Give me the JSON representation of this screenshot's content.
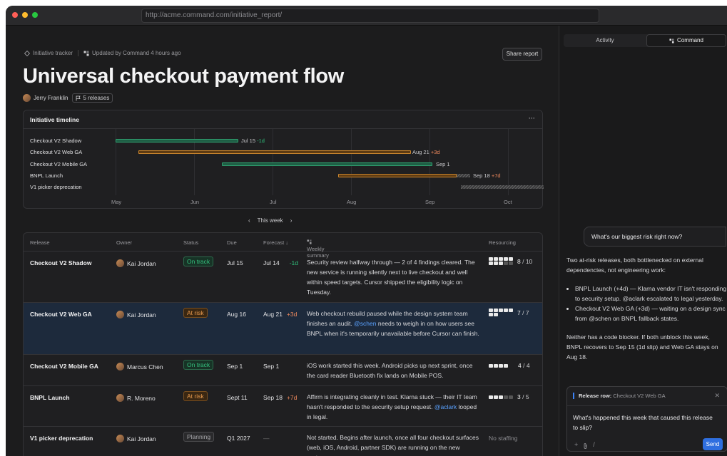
{
  "browser": {
    "url": "http://acme.command.com/initiative_report/"
  },
  "breadcrumbs": {
    "tracker": "Initiative tracker",
    "updated": "Updated by Command 4 hours ago"
  },
  "header": {
    "share_label": "Share report",
    "title": "Universal checkout payment flow",
    "owner": "Jerry Franklin",
    "releases_pill": "5 releases"
  },
  "timeline": {
    "title": "Initiative timeline",
    "more": "···",
    "months": [
      "May",
      "Jun",
      "Jul",
      "Aug",
      "Sep",
      "Oct"
    ],
    "rows": [
      {
        "label": "Checkout V2 Shadow",
        "note": "Jul 15",
        "delta": "-1d",
        "tone": "green"
      },
      {
        "label": "Checkout V2 Web GA",
        "note": "Aug 21",
        "delta": "+3d",
        "tone": "orange"
      },
      {
        "label": "Checkout V2 Mobile GA",
        "note": "Sep 1",
        "delta": "",
        "tone": "green"
      },
      {
        "label": "BNPL Launch",
        "note": "Sep 18",
        "delta": "+7d",
        "tone": "orange"
      },
      {
        "label": "V1 picker deprecation",
        "note": "",
        "delta": "",
        "tone": "grey"
      }
    ]
  },
  "weeknav": {
    "prev": "‹",
    "label": "This week",
    "next": "›"
  },
  "table": {
    "headers": {
      "release": "Release",
      "owner": "Owner",
      "status": "Status",
      "due": "Due",
      "forecast": "Forecast ↓",
      "summary": "Weekly summary",
      "resourcing": "Resourcing"
    },
    "rows": [
      {
        "release": "Checkout V2 Shadow",
        "owner": "Kai Jordan",
        "status": "On track",
        "due": "Jul 15",
        "forecast": "Jul 14",
        "delta": "-1d",
        "summary": "Security review halfway through — 2 of 4 findings cleared. The new service is running silently next to live checkout and well within speed targets. Cursor shipped the eligibility logic on Tuesday.",
        "res_used": "8",
        "res_total": "/ 10"
      },
      {
        "release": "Checkout V2 Web GA",
        "owner": "Kai Jordan",
        "status": "At risk",
        "due": "Aug 16",
        "forecast": "Aug 21",
        "delta": "+3d",
        "summary_a": "Web checkout rebuild paused while the design system team finishes an audit.",
        "summary_mention": "@schen",
        "summary_b": "needs to weigh in on how users see BNPL when it's temporarily unavailable before Cursor can finish.",
        "res_used": "7",
        "res_total": "/ 7"
      },
      {
        "release": "Checkout V2 Mobile GA",
        "owner": "Marcus Chen",
        "status": "On track",
        "due": "Sep 1",
        "forecast": "Sep 1",
        "summary": "iOS work started this week. Android picks up next sprint, once the card reader Bluetooth fix lands on Mobile POS.",
        "res_used": "4",
        "res_total": "/ 4"
      },
      {
        "release": "BNPL Launch",
        "owner": "R. Moreno",
        "status": "At risk",
        "due": "Sept 11",
        "forecast": "Sep 18",
        "delta": "+7d",
        "summary_a": "Affirm is integrating cleanly in test. Klarna stuck — their IT team hasn't responded to the security setup request.",
        "summary_mention": "@aclark",
        "summary_b": "looped in legal.",
        "res_used": "3",
        "res_total": "/ 5"
      },
      {
        "release": "V1 picker deprecation",
        "owner": "Kai Jordan",
        "status": "Planning",
        "due": "Q1 2027",
        "forecast": "—",
        "summary": "Not started. Begins after launch, once all four checkout surfaces (web, iOS, Android, partner SDK) are running on the new system.",
        "resourcing": "No staffing"
      }
    ]
  },
  "sidebar": {
    "tab_activity": "Activity",
    "tab_command": "Command",
    "question": "What's our biggest risk right now?",
    "answer_intro": "Two at-risk releases, both bottlenecked on external dependencies, not engineering work:",
    "answer_bullet_1": "BNPL Launch (+4d) — Klarna vendor IT isn't responding to security setup. @aclark escalated to legal yesterday.",
    "answer_bullet_2": "Checkout V2 Web GA (+3d) — waiting on a design sync from @schen on BNPL fallback states.",
    "answer_outro": "Neither has a code blocker. If both unblock this week, BNPL recovers to Sep 15 (1d slip) and Web GA stays on Aug 18.",
    "context_label": "Release row:",
    "context_value": "Checkout V2 Web GA",
    "prompt": "What's happened this week that caused this release to slip?",
    "send": "Send"
  },
  "colors": {
    "accent": "#2f6fe0",
    "on_track": "#35c27f",
    "at_risk": "#e89a4e",
    "mention": "#5aa2ff"
  }
}
